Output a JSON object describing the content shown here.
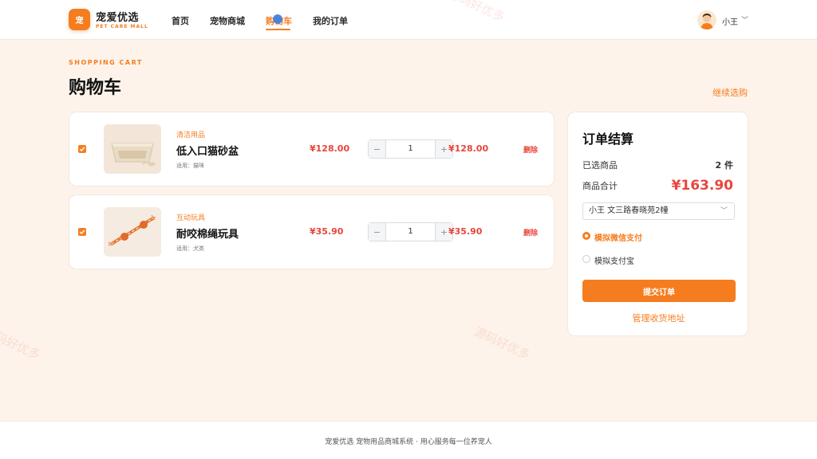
{
  "header": {
    "logo_text": "宠",
    "brand_name": "宠爱优选",
    "brand_sub": "PET CARE MALL",
    "nav": [
      {
        "label": "首页"
      },
      {
        "label": "宠物商城"
      },
      {
        "label": "购物车"
      },
      {
        "label": "我的订单"
      }
    ],
    "user_name": "小王",
    "user_chevron": "﹀"
  },
  "watermark": "源码好优多",
  "page": {
    "eyebrow": "SHOPPING CART",
    "title": "购物车",
    "continue_link": "继续选购"
  },
  "cart": {
    "items": [
      {
        "category": "清洁用品",
        "name": "低入口猫砂盆",
        "for": "适用：猫咪",
        "price": "¥128.00",
        "quantity": "1",
        "subtotal": "¥128.00",
        "delete_label": "删除",
        "checked": true,
        "image": "litter-box"
      },
      {
        "category": "互动玩具",
        "name": "耐咬棉绳玩具",
        "for": "适用：犬类",
        "price": "¥35.90",
        "quantity": "1",
        "subtotal": "¥35.90",
        "delete_label": "删除",
        "checked": true,
        "image": "rope-toy"
      }
    ],
    "minus_label": "−",
    "plus_label": "+"
  },
  "summary": {
    "title": "订单结算",
    "selected_label": "已选商品",
    "selected_count": "2 件",
    "total_label": "商品合计",
    "total_value": "¥163.90",
    "address": "小王 文三路春晓苑2幢",
    "payment_options": [
      {
        "label": "模拟微信支付",
        "selected": true
      },
      {
        "label": "模拟支付宝",
        "selected": false
      }
    ],
    "submit_label": "提交订单",
    "manage_address_label": "管理收货地址"
  },
  "footer": {
    "text": "宠爱优选 宠物用品商城系统 · 用心服务每一位养宠人"
  },
  "colors": {
    "accent": "#f57d1f",
    "price": "#e8453c",
    "background": "#fdf3ea"
  }
}
